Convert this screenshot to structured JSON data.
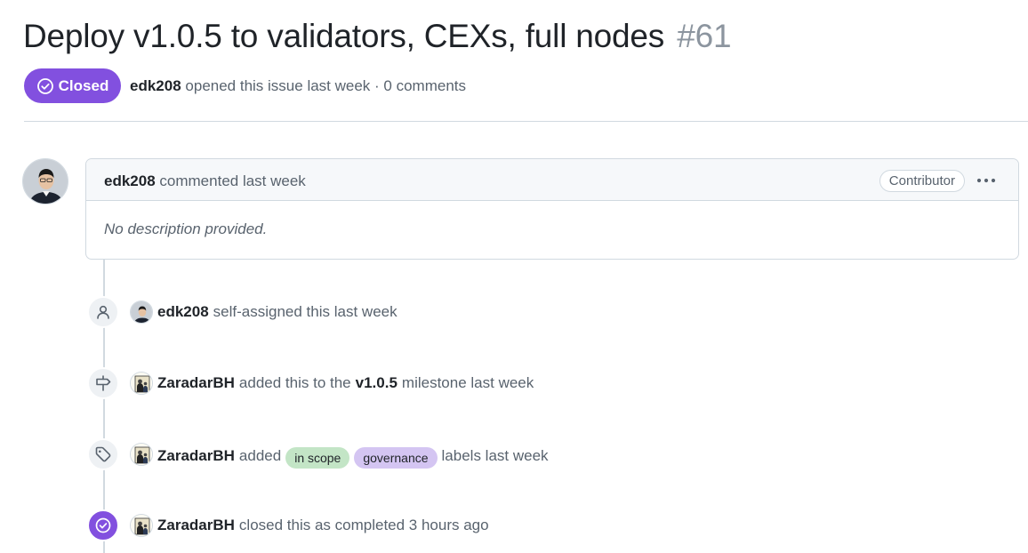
{
  "issue": {
    "title": "Deploy v1.0.5 to validators, CEXs, full nodes",
    "number": "#61",
    "state": "Closed",
    "author": "edk208",
    "opened_text": "opened this issue last week · 0 comments"
  },
  "comment": {
    "author": "edk208",
    "action": "commented last week",
    "role_badge": "Contributor",
    "body": "No description provided."
  },
  "timeline": [
    {
      "actor": "edk208",
      "icon": "person-icon",
      "pre": "self-assigned this last week"
    },
    {
      "actor": "ZaradarBH",
      "icon": "milestone-icon",
      "pre": "added this to the",
      "strong": "v1.0.5",
      "post": "milestone last week"
    },
    {
      "actor": "ZaradarBH",
      "icon": "tag-icon",
      "pre": "added",
      "labels": [
        "in scope",
        "governance"
      ],
      "post": "labels last week"
    },
    {
      "actor": "ZaradarBH",
      "icon": "check-circle-icon",
      "pre": "closed this as completed 3 hours ago"
    }
  ],
  "colors": {
    "closed": "#8250df",
    "label_in_scope": "#c3e5c6",
    "label_governance": "#d4c5f2"
  }
}
